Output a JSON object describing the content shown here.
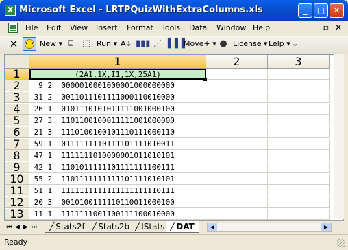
{
  "window": {
    "title": "Microsoft Excel - LRTPQuizWithExtraColumns.xls",
    "minimize_glyph": "_",
    "maximize_glyph": "□",
    "close_glyph": "✕"
  },
  "menubar": {
    "items": [
      "File",
      "Edit",
      "View",
      "Insert",
      "Format",
      "Tools",
      "Data",
      "Window",
      "Help"
    ],
    "right": {
      "minimize": "_",
      "restore": "⧉",
      "close": "✕"
    }
  },
  "toolbar": {
    "new_label": "New",
    "run_label": "Run",
    "move_label": "Move+",
    "license_label": "License",
    "help_label": "Lelp"
  },
  "grid": {
    "column_headers": [
      "1",
      "2",
      "3"
    ],
    "row_headers": [
      "1",
      "2",
      "3",
      "4",
      "5",
      "6",
      "7",
      "8",
      "9",
      "10",
      "11",
      "12",
      "13"
    ],
    "format_cell": "(2A1,1X,I1,1X,25A1)",
    "rows": [
      "  9 2  0000010001000001000000000",
      " 31 2  0011011101111000110010000",
      " 26 1  0101110101011111001000100",
      " 27 3  1101100100011111001000000",
      " 21 3  1110100100101110111000110",
      " 59 1  0111111110111101111010011",
      " 47 1  1111111010000001011010101",
      " 42 1  1101011111101111111100111",
      " 55 2  1101111111111101111010101",
      " 51 1  1111111111111111111110111",
      " 20 3  0010100111110110011000100",
      " 11 1  1111111001100111100010000"
    ]
  },
  "sheet_tabs": {
    "tabs": [
      "Stats2f",
      "Stats2b",
      "IStats",
      "DAT"
    ],
    "active": "DAT"
  },
  "status": {
    "text": "Ready"
  }
}
